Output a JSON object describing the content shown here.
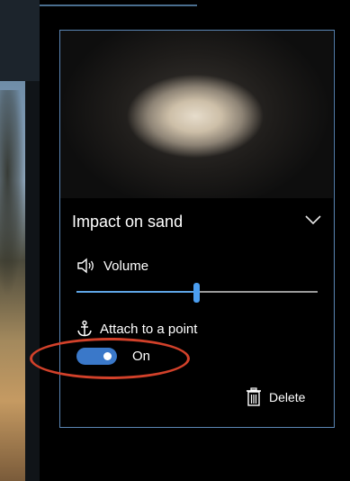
{
  "panel": {
    "sound_title": "Impact on sand",
    "volume_label": "Volume",
    "volume_level": 0.5,
    "attach_label": "Attach to a point",
    "toggle_state": "On",
    "delete_label": "Delete"
  },
  "colors": {
    "accent": "#3a78c9",
    "panel_border": "#5b86b5",
    "highlight": "#d2412a"
  }
}
